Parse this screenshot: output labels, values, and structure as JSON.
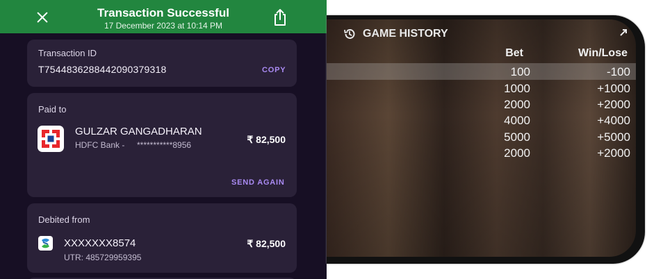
{
  "receipt": {
    "title": "Transaction Successful",
    "datetime": "17 December 2023 at 10:14 PM",
    "header_color": "#22863f",
    "transaction": {
      "label": "Transaction ID",
      "id": "T754483628844209037931​8",
      "copy_label": "COPY"
    },
    "paid_to": {
      "label": "Paid to",
      "name": "GULZAR GANGADHARAN",
      "bank": "HDFC Bank -",
      "account_masked": "***********8956",
      "amount": "₹ 82,500",
      "send_again_label": "SEND AGAIN",
      "logo_icon": "hdfc-bank-logo"
    },
    "debited_from": {
      "label": "Debited from",
      "account": "XXXXXXX8574",
      "utr": "UTR: 485729959395",
      "amount": "₹ 82,500",
      "logo_icon": "standard-chartered-logo"
    }
  },
  "game_history": {
    "title": "GAME HISTORY",
    "col_bet": "Bet",
    "col_win": "Win/Lose",
    "rows": [
      {
        "bet": "100",
        "win": "-100"
      },
      {
        "bet": "1000",
        "win": "+1000"
      },
      {
        "bet": "2000",
        "win": "+2000"
      },
      {
        "bet": "4000",
        "win": "+4000"
      },
      {
        "bet": "5000",
        "win": "+5000"
      },
      {
        "bet": "2000",
        "win": "+2000"
      }
    ]
  }
}
